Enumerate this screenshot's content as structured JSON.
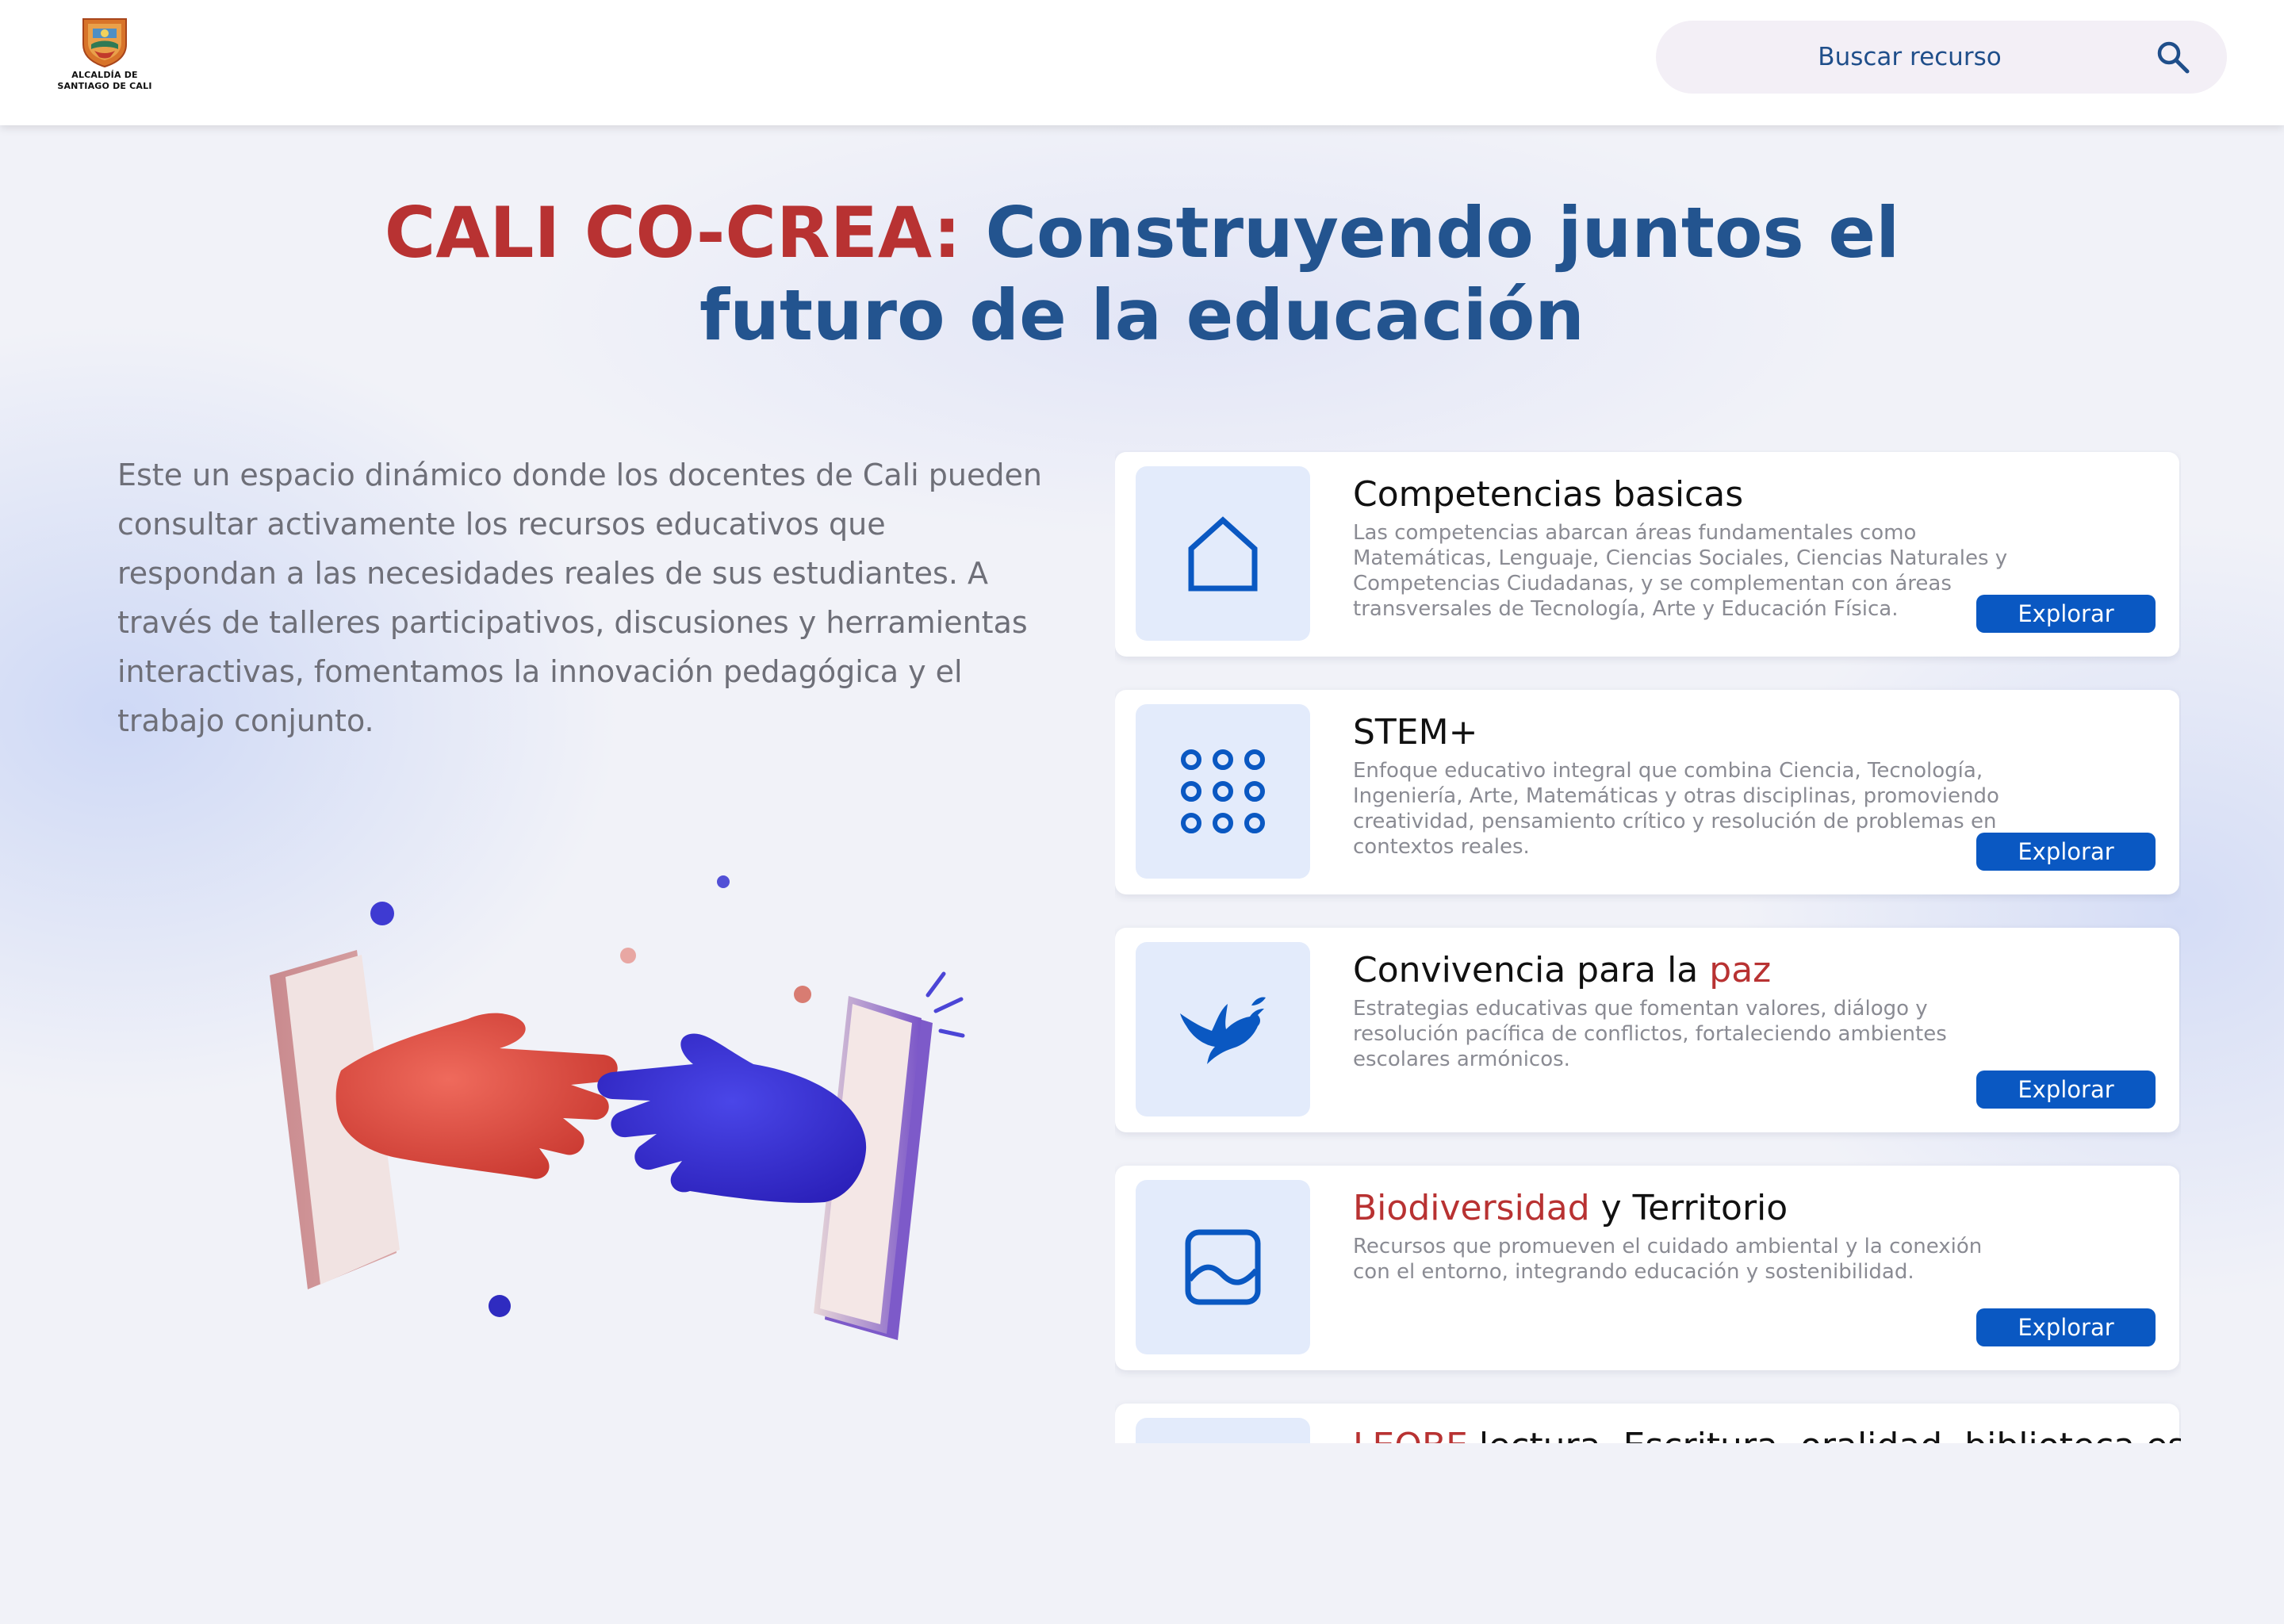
{
  "header": {
    "logo_lines": [
      "ALCALDÍA DE",
      "SANTIAGO DE CALI"
    ],
    "search_placeholder": "Buscar recurso",
    "search_icon": "search-icon"
  },
  "hero": {
    "title_accent": "CALI CO-CREA:",
    "title_rest": " Construyendo juntos el futuro de la educación",
    "intro": "Este un espacio dinámico donde los docentes de Cali pueden consultar activamente los recursos educativos que respondan a las necesidades reales de sus estudiantes. A través de talleres participativos, discusiones y herramientas interactivas, fomentamos la innovación pedagógica y el trabajo conjunto."
  },
  "illustration": {
    "icon": "hands-reaching-phones-illustration"
  },
  "cards": [
    {
      "title_pre": "Competencias basicas",
      "title_red": "",
      "title_post": "",
      "description": "Las competencias abarcan áreas fundamentales como Matemáticas, Lenguaje, Ciencias Sociales, Ciencias Naturales y Competencias Ciudadanas, y se complementan con áreas transversales de Tecnología, Arte y Educación Física.",
      "button": "Explorar",
      "icon": "home-icon"
    },
    {
      "title_pre": "STEM+",
      "title_red": "",
      "title_post": "",
      "description": "Enfoque educativo integral que combina Ciencia, Tecnología, Ingeniería, Arte, Matemáticas y otras disciplinas, promoviendo creatividad, pensamiento crítico y resolución de problemas en contextos reales.",
      "button": "Explorar",
      "icon": "apps-grid-icon"
    },
    {
      "title_pre": "Convivencia para la ",
      "title_red": "paz",
      "title_post": "",
      "description": "Estrategias educativas que fomentan valores, diálogo y resolución pacífica de conflictos, fortaleciendo ambientes escolares armónicos.",
      "button": "Explorar",
      "icon": "dove-icon"
    },
    {
      "title_pre": "",
      "title_red": "Biodiversidad",
      "title_post": " y Territorio",
      "description": "Recursos que promueven el cuidado ambiental y la conexión con el entorno, integrando educación y sostenibilidad.",
      "button": "Explorar",
      "icon": "landscape-image-icon"
    },
    {
      "title_pre": "",
      "title_red": "LEOBE",
      "title_post": " lectura, Escritura, oralidad, biblioteca escolar",
      "description": "",
      "button": "",
      "icon": "book-icon"
    }
  ],
  "colors": {
    "brand_blue": "#23548f",
    "brand_red": "#b83232",
    "button_blue": "#0a58c2",
    "card_thumb": "#e3ebfb"
  }
}
